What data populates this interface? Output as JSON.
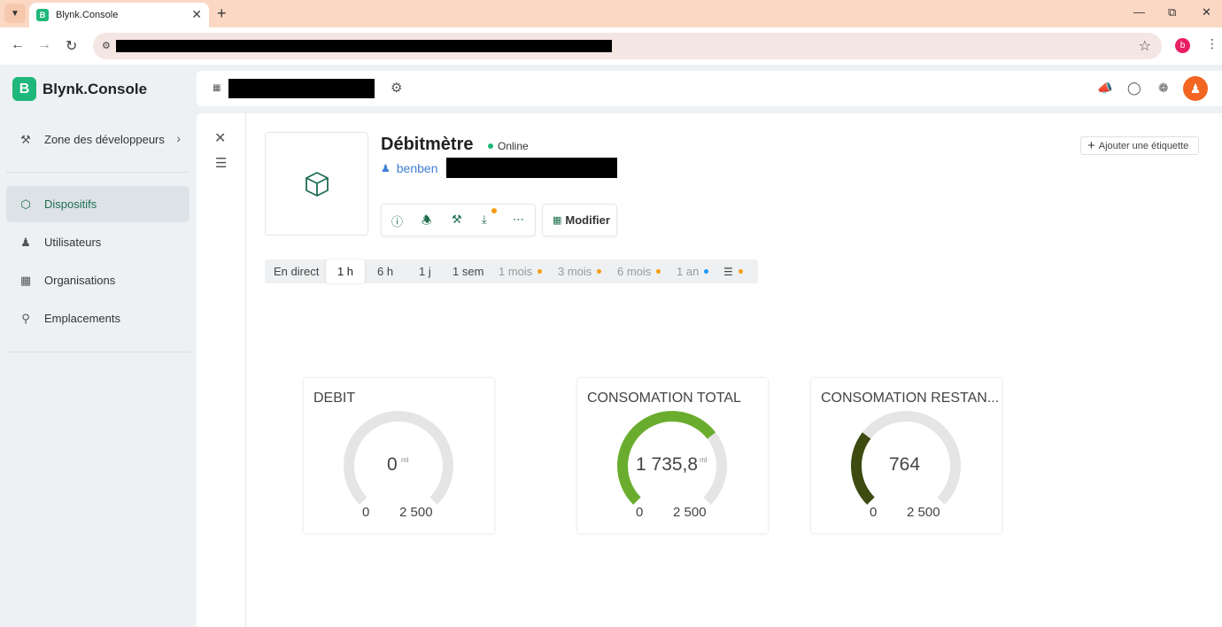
{
  "browser": {
    "tab_title": "Blynk.Console",
    "favicon_letter": "B",
    "profile_letter": "b"
  },
  "app": {
    "brand_letter": "B",
    "brand_name": "Blynk.Console",
    "accent_color": "#1fb77a",
    "sidebar": {
      "dev_zone": "Zone des développeurs",
      "items": [
        {
          "label": "Dispositifs",
          "icon": "cube-icon",
          "active": true
        },
        {
          "label": "Utilisateurs",
          "icon": "users-icon",
          "active": false
        },
        {
          "label": "Organisations",
          "icon": "building-icon",
          "active": false
        },
        {
          "label": "Emplacements",
          "icon": "location-pin-icon",
          "active": false
        }
      ]
    }
  },
  "device": {
    "title": "Débitmètre",
    "status": "Online",
    "owner": "benben",
    "modify_label": "Modifier",
    "add_label": "Ajouter une étiquette"
  },
  "time_ranges": [
    {
      "label": "En direct",
      "state": "normal"
    },
    {
      "label": "1 h",
      "state": "active"
    },
    {
      "label": "6 h",
      "state": "normal"
    },
    {
      "label": "1 j",
      "state": "normal"
    },
    {
      "label": "1 sem",
      "state": "normal"
    },
    {
      "label": "1 mois",
      "state": "muted",
      "dot": "orange"
    },
    {
      "label": "3 mois",
      "state": "muted",
      "dot": "orange"
    },
    {
      "label": "6 mois",
      "state": "muted",
      "dot": "orange"
    },
    {
      "label": "1 an",
      "state": "muted",
      "dot": "blue"
    }
  ],
  "widgets": [
    {
      "title": "DEBIT",
      "value": 0,
      "value_text": "0",
      "unit": "ml",
      "min": 0,
      "max": 2500,
      "min_text": "0",
      "max_text": "2 500",
      "color": "#7cb342"
    },
    {
      "title": "CONSOMATION TOTAL",
      "value": 1735.8,
      "value_text": "1 735,8",
      "unit": "ml",
      "min": 0,
      "max": 2500,
      "min_text": "0",
      "max_text": "2 500",
      "color": "#6aad2e"
    },
    {
      "title": "CONSOMATION RESTAN...",
      "value": 764,
      "value_text": "764",
      "unit": "",
      "min": 0,
      "max": 2500,
      "min_text": "0",
      "max_text": "2 500",
      "color": "#3d4a10"
    }
  ]
}
